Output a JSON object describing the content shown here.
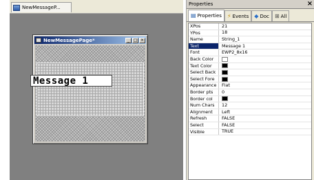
{
  "designer": {
    "tab_label": "NewMessageP...",
    "tab_icon": "page-icon",
    "dialog": {
      "title": "NewMessagePage*",
      "minimize_glyph": "_",
      "maximize_glyph": "□",
      "close_glyph": "×",
      "message_text": "Message 1"
    }
  },
  "properties": {
    "title": "Properties",
    "close_glyph": "×",
    "tabs": [
      {
        "label": "Properties",
        "icon": "properties-icon",
        "glyph": "▤"
      },
      {
        "label": "Events",
        "icon": "events-icon",
        "glyph": "⚡"
      },
      {
        "label": "Doc",
        "icon": "doc-icon",
        "glyph": "◆"
      },
      {
        "label": "All",
        "icon": "all-icon",
        "glyph": "⊞"
      }
    ],
    "rows": [
      {
        "name": "XPos",
        "value": "21"
      },
      {
        "name": "YPos",
        "value": "18"
      },
      {
        "name": "Name",
        "value": "String_1"
      },
      {
        "name": "Text",
        "value": "Message 1",
        "selected": true
      },
      {
        "name": "Font",
        "value": "EWP2_8x16"
      },
      {
        "name": "Back Color",
        "swatch": "white"
      },
      {
        "name": "Text Color",
        "swatch": "black"
      },
      {
        "name": "Select Back",
        "swatch": "black"
      },
      {
        "name": "Select Fore",
        "swatch": "black"
      },
      {
        "name": "Appearance",
        "value": "Flat"
      },
      {
        "name": "Border pts",
        "value": "0"
      },
      {
        "name": "Border col",
        "swatch": "black"
      },
      {
        "name": "Num Chars",
        "value": "12"
      },
      {
        "name": "Alignment",
        "value": "Left"
      },
      {
        "name": "Refresh",
        "value": "FALSE"
      },
      {
        "name": "Select",
        "value": "FALSE"
      },
      {
        "name": "Visible",
        "value": "TRUE"
      }
    ],
    "colors": {
      "selection": "#0a246a",
      "titlebar_start": "#0a246a",
      "titlebar_end": "#a6caf0"
    }
  }
}
